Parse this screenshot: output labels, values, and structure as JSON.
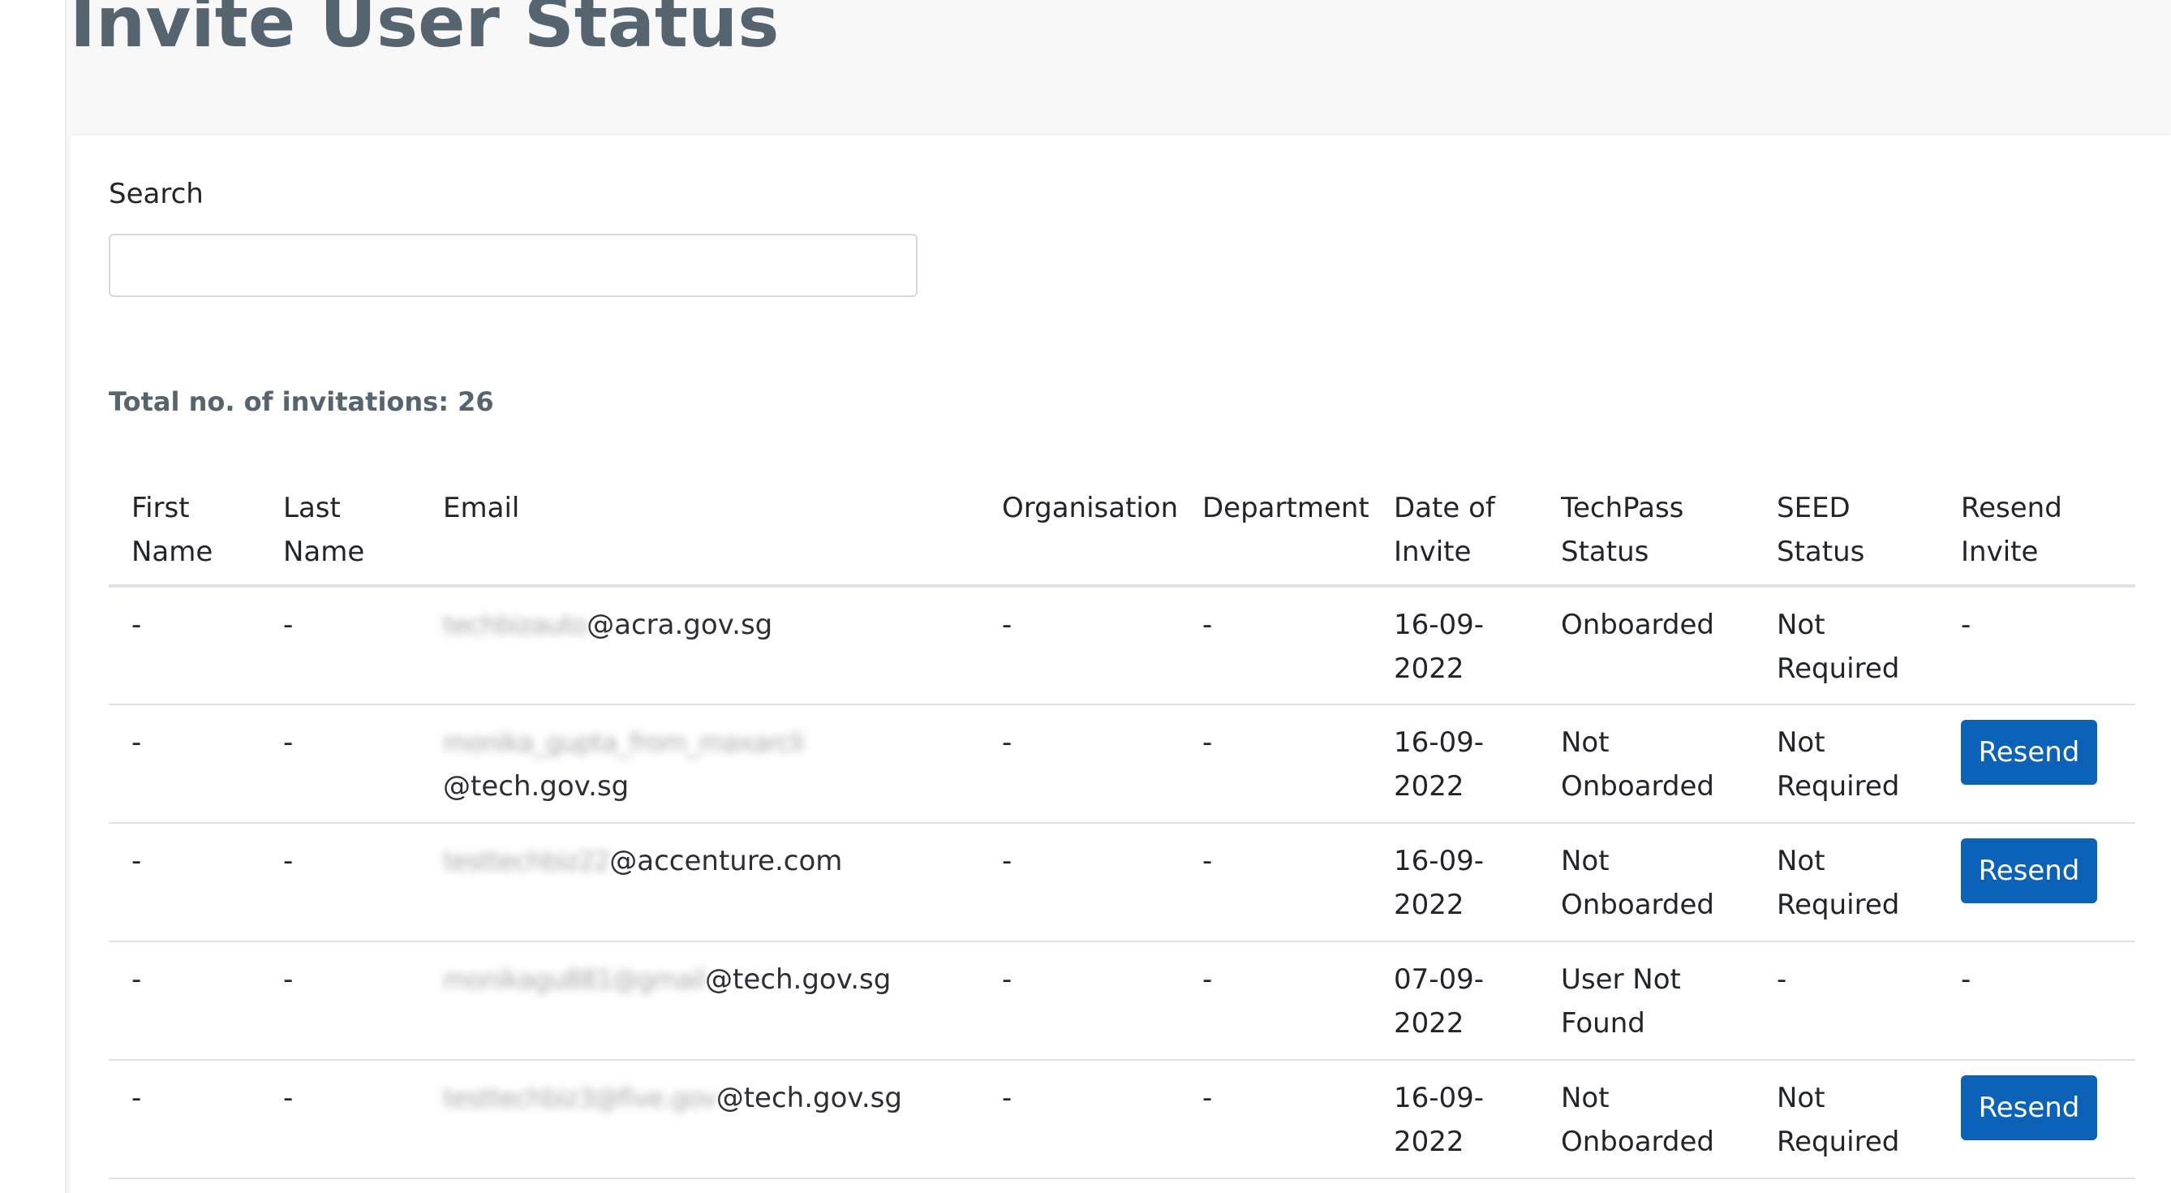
{
  "page": {
    "title": "Invite User Status",
    "search_label": "Search",
    "search_value": "",
    "total_label": "Total no. of invitations: 26"
  },
  "colors": {
    "title": "#56646f",
    "resend_button": "#0b62b6",
    "table_border": "#dee2e6"
  },
  "table": {
    "headers": {
      "first_name": "First Name",
      "last_name": "Last Name",
      "email": "Email",
      "organisation": "Organisation",
      "department": "Department",
      "date_of_invite": "Date of Invite",
      "techpass_status": "TechPass Status",
      "seed_status": "SEED Status",
      "resend_invite": "Resend Invite"
    },
    "rows": [
      {
        "first_name": "-",
        "last_name": "-",
        "email_user": "techbizauto",
        "email_domain": "@acra.gov.sg",
        "organisation": "-",
        "department": "-",
        "date": "16-09-2022",
        "techpass": "Onboarded",
        "seed": "Not Required",
        "resend": "-"
      },
      {
        "first_name": "-",
        "last_name": "-",
        "email_user": "monika_gupta_from_maxarcli",
        "email_domain": "@tech.gov.sg",
        "organisation": "-",
        "department": "-",
        "date": "16-09-2022",
        "techpass": "Not Onboarded",
        "seed": "Not Required",
        "resend": "Resend"
      },
      {
        "first_name": "-",
        "last_name": "-",
        "email_user": "testtechbiz22",
        "email_domain": "@accenture.com",
        "organisation": "-",
        "department": "-",
        "date": "16-09-2022",
        "techpass": "Not Onboarded",
        "seed": "Not Required",
        "resend": "Resend"
      },
      {
        "first_name": "-",
        "last_name": "-",
        "email_user": "monikagu881@gmail",
        "email_domain": "@tech.gov.sg",
        "organisation": "-",
        "department": "-",
        "date": "07-09-2022",
        "techpass": "User Not Found",
        "seed": "-",
        "resend": "-"
      },
      {
        "first_name": "-",
        "last_name": "-",
        "email_user": "testtechbiz3@five.gov",
        "email_domain": "@tech.gov.sg",
        "organisation": "-",
        "department": "-",
        "date": "16-09-2022",
        "techpass": "Not Onboarded",
        "seed": "Not Required",
        "resend": "Resend"
      }
    ]
  }
}
